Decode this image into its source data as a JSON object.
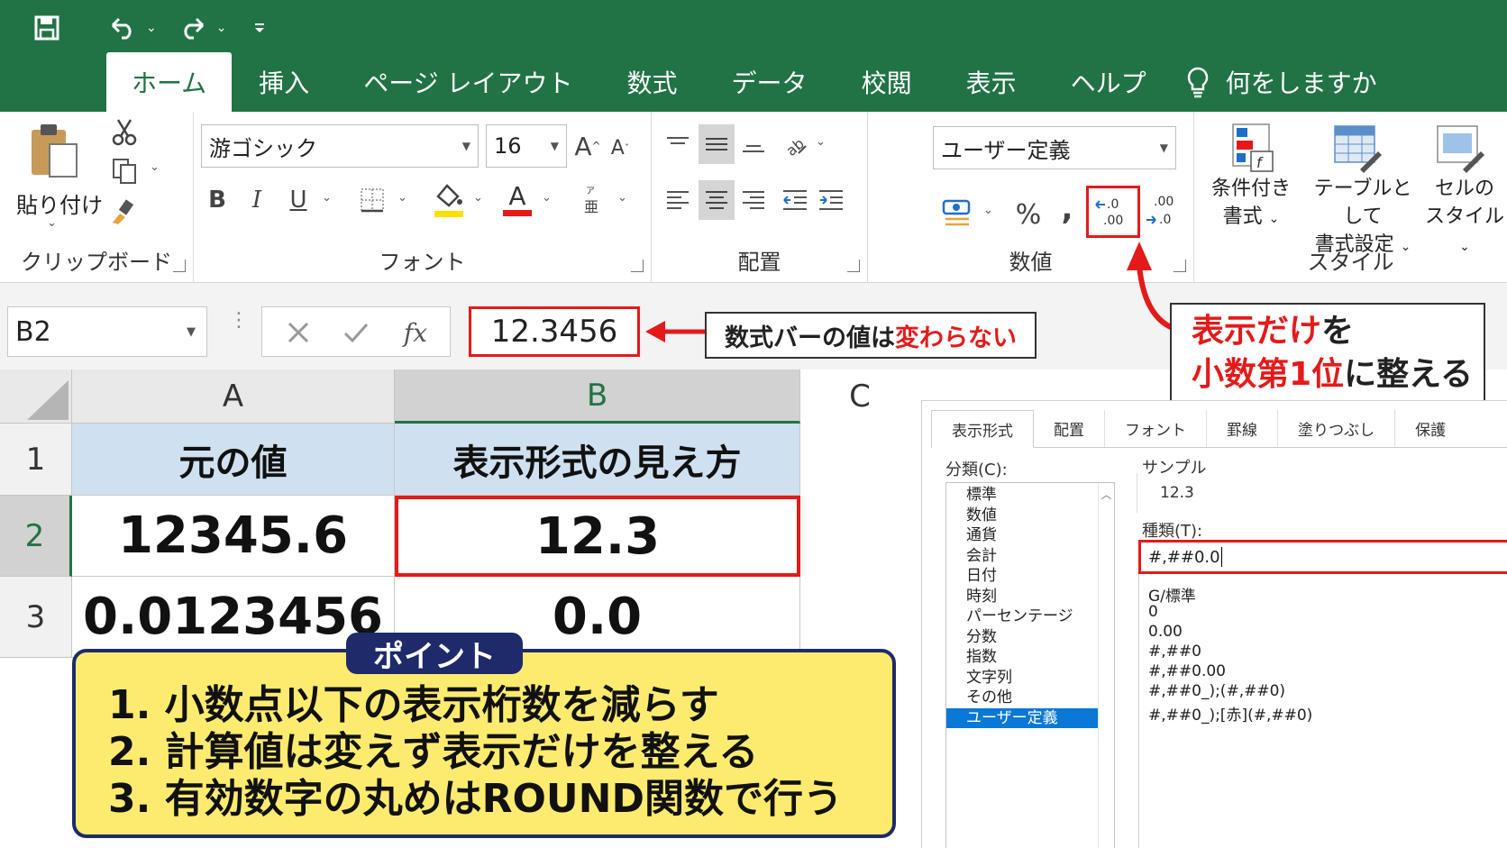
{
  "qat": {
    "undo_caret": "⌄",
    "redo_caret": "⌄"
  },
  "tabs": [
    "ホーム",
    "挿入",
    "ページ レイアウト",
    "数式",
    "データ",
    "校閲",
    "表示",
    "ヘルプ",
    "何をしますか"
  ],
  "ribbon": {
    "clipboard": {
      "paste_label": "貼り付け",
      "group_label": "クリップボード"
    },
    "font": {
      "font_name": "游ゴシック",
      "font_size": "16",
      "grow": "A",
      "shrink": "A",
      "bold": "B",
      "italic": "I",
      "underline": "U",
      "font_color_glyph": "A",
      "group_label": "フォント"
    },
    "alignment": {
      "group_label": "配置"
    },
    "number": {
      "format": "ユーザー定義",
      "percent": "%",
      "comma": ",",
      "group_label": "数値"
    },
    "styles": {
      "conditional_line1": "条件付き",
      "conditional_line2": "書式",
      "table_line1": "テーブルとして",
      "table_line2": "書式設定",
      "cell_line1": "セルの",
      "cell_line2": "スタイル",
      "group_label": "スタイル"
    }
  },
  "formula_bar": {
    "name_box": "B2",
    "fx": "fx",
    "value": "12.3456"
  },
  "callouts": {
    "formula_note_prefix": "数式バーの値は",
    "formula_note_highlight": "変わらない",
    "decimal_note_line1_highlight": "表示だけ",
    "decimal_note_line1_suffix": "を",
    "decimal_note_line2_highlight": "小数第1位",
    "decimal_note_line2_suffix": "に整える"
  },
  "sheet": {
    "columns": [
      "A",
      "B",
      "C"
    ],
    "rows": [
      "1",
      "2",
      "3"
    ],
    "header": [
      "元の値",
      "表示形式の見え方"
    ],
    "data": [
      [
        "12345.6",
        "12.3"
      ],
      [
        "0.0123456",
        "0.0"
      ]
    ]
  },
  "point": {
    "tag": "ポイント",
    "lines": [
      "1. 小数点以下の表示桁数を減らす",
      "2. 計算値は変えず表示だけを整える",
      "3. 有効数字の丸めはROUND関数で行う"
    ]
  },
  "dialog": {
    "tabs": [
      "表示形式",
      "配置",
      "フォント",
      "罫線",
      "塗りつぶし",
      "保護"
    ],
    "category_label": "分類(C):",
    "categories": [
      "標準",
      "数値",
      "通貨",
      "会計",
      "日付",
      "時刻",
      "パーセンテージ",
      "分数",
      "指数",
      "文字列",
      "その他",
      "ユーザー定義"
    ],
    "sample_label": "サンプル",
    "sample_value": "12.3",
    "type_label": "種類(T):",
    "type_value": "#,##0.0",
    "type_list": [
      "G/標準",
      "0",
      "0.00",
      "#,##0",
      "#,##0.00",
      "#,##0_);(#,##0)",
      "#,##0_);[赤](#,##0)"
    ]
  },
  "colors": {
    "excel_green": "#217346",
    "highlight_red": "#e41a1a",
    "point_yellow": "#fdeb6f",
    "point_navy": "#1f2a6b",
    "header_blue": "#cfe0f1",
    "selected_blue": "#0a78d7"
  }
}
